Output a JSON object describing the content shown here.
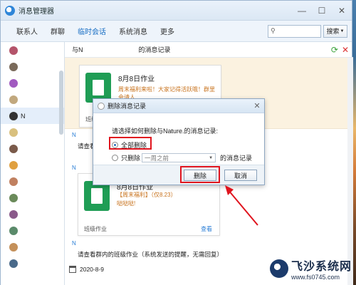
{
  "window": {
    "title": "消息管理器"
  },
  "nav": {
    "items": [
      "联系人",
      "群聊",
      "临时会话",
      "系统消息",
      "更多"
    ],
    "active_index": 2,
    "search_placeholder": "",
    "search_button": "搜索"
  },
  "contacts": [
    {
      "name": "",
      "color": "#b4546a"
    },
    {
      "name": "",
      "color": "#7a6a5a"
    },
    {
      "name": "",
      "color": "#a15ac0"
    },
    {
      "name": "",
      "color": "#c1a87e"
    },
    {
      "name": "N",
      "color": "#333333",
      "selected": true
    },
    {
      "name": "",
      "color": "#d9c07e"
    },
    {
      "name": "",
      "color": "#7a5a4a"
    },
    {
      "name": "",
      "color": "#e0a040"
    },
    {
      "name": "",
      "color": "#c08060"
    },
    {
      "name": "",
      "color": "#6a8a5a"
    },
    {
      "name": "",
      "color": "#8a5a8a"
    },
    {
      "name": "",
      "color": "#5a8a6a"
    },
    {
      "name": "",
      "color": "#c4905a"
    },
    {
      "name": "",
      "color": "#4a6a8a"
    }
  ],
  "content": {
    "header_prefix": "与N",
    "header_suffix": "的消息记录",
    "card1": {
      "title": "8月8日作业",
      "desc": "周末福利来啦！大家记得活跃哦！群里会请人",
      "footer": "班级"
    },
    "sender1": "N",
    "line1": "请查看",
    "sender2": "N",
    "card2": {
      "title": "8月8日作业",
      "desc": "【周末福利】（仅8.23）",
      "desc2": "哒哒哒!",
      "footer": "班级作业",
      "link": "查看"
    },
    "sender3": "N",
    "line2": "请查看群内的班级作业（系统发送的提醒，无需回复）",
    "date": "2020-8-9"
  },
  "dialog": {
    "title": "删除消息记录",
    "prompt": "请选择如何删除与Nature.的消息记录:",
    "option_all": "全部删除",
    "option_partial": "只删除",
    "partial_value": "一周之前",
    "partial_suffix": "的消息记录",
    "selected": "all",
    "delete_button": "删除",
    "cancel_button": "取消"
  },
  "watermark": {
    "title": "飞沙系统网",
    "url": "www.fs0745.com"
  },
  "colors": {
    "accent": "#1a6fc4",
    "highlight": "#e0141e",
    "doc_green": "#1f9d55"
  }
}
